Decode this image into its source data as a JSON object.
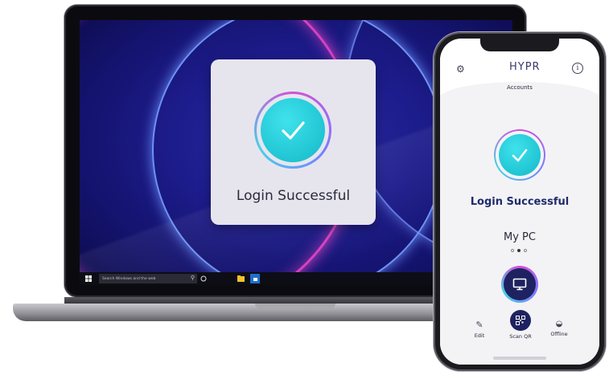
{
  "laptop": {
    "login_message": "Login Successful",
    "taskbar": {
      "search_placeholder": "Search Windows and the web"
    }
  },
  "phone": {
    "logo": "HYPR",
    "header_tab": "Accounts",
    "login_message": "Login Successful",
    "device_name": "My PC",
    "carousel": {
      "count": 3,
      "active_index": 1
    },
    "actions": {
      "edit_label": "Edit",
      "scan_label": "Scan QR",
      "offline_label": "Offline"
    }
  },
  "colors": {
    "accent_teal": "#13b8c8",
    "accent_magenta": "#d44fd7",
    "navy": "#1e2260",
    "title_blue": "#1f2b6a"
  },
  "icons": [
    "check-icon",
    "windows-icon",
    "search-icon",
    "task-view-icon",
    "file-explorer-icon",
    "store-icon",
    "gear-icon",
    "info-icon",
    "monitor-icon",
    "pencil-icon",
    "qr-code-icon",
    "offline-icon"
  ]
}
